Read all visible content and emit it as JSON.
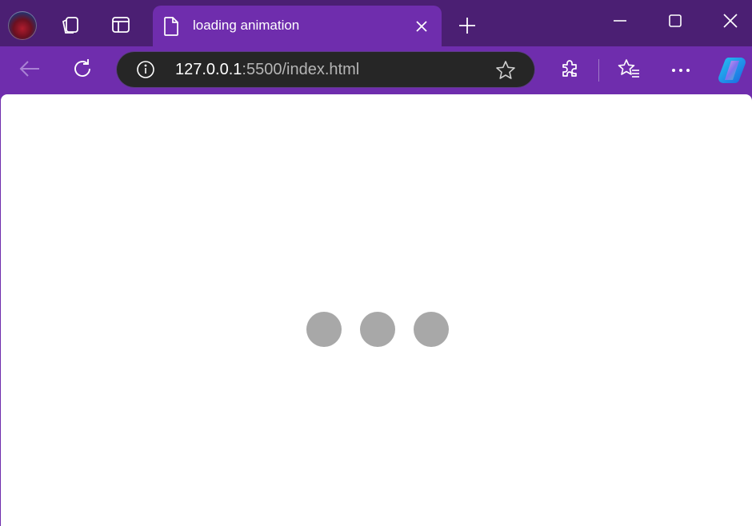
{
  "window": {
    "tab": {
      "title": "loading animation",
      "icon": "document-icon"
    },
    "controls": [
      "minimize-icon",
      "maximize-icon",
      "close-icon"
    ]
  },
  "toolbar": {
    "address": {
      "host": "127.0.0.1",
      "rest": ":5500/index.html"
    }
  },
  "colors": {
    "titlebar": "#4b1f73",
    "toolbar": "#6f2dad",
    "address_bg": "#262626",
    "page_bg": "#ffffff",
    "dot": "#a8a8a8"
  },
  "page": {
    "loader": {
      "dot_count": 3
    }
  }
}
